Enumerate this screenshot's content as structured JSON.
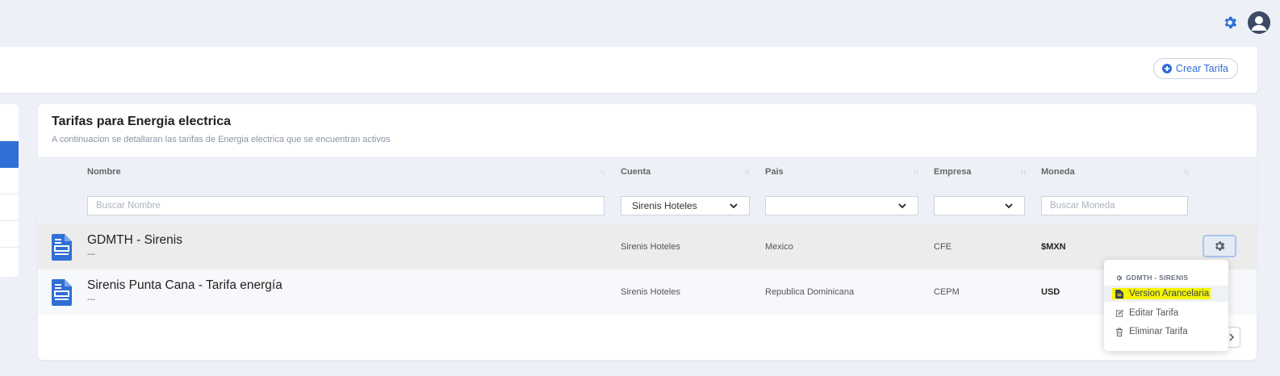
{
  "header": {
    "create_button": "Crear Tarifa"
  },
  "card": {
    "title": "Tarifas para Energia electrica",
    "subtitle": "A continuacion se detallaran las tarifas de Energia electrica que se encuentran activos"
  },
  "table": {
    "columns": [
      "Nombre",
      "Cuenta",
      "Pais",
      "Empresa",
      "Moneda"
    ],
    "sort_glyph": "↑↓",
    "filters": {
      "nombre_placeholder": "Buscar Nombre",
      "cuenta_selected": "Sirenis Hoteles",
      "pais_selected": "",
      "empresa_selected": "",
      "moneda_placeholder": "Buscar Moneda"
    },
    "rows": [
      {
        "nombre": "GDMTH - Sirenis",
        "sub": "---",
        "cuenta": "Sirenis Hoteles",
        "pais": "Mexico",
        "empresa": "CFE",
        "moneda": "$MXN"
      },
      {
        "nombre": "Sirenis Punta Cana - Tarifa energía",
        "sub": "---",
        "cuenta": "Sirenis Hoteles",
        "pais": "Republica Dominicana",
        "empresa": "CEPM",
        "moneda": "USD"
      }
    ]
  },
  "dropdown": {
    "header": "GDMTH - SIRENIS",
    "items": [
      "Version Arancelaria",
      "Editar Tarifa",
      "Eliminar Tarifa"
    ]
  },
  "icons": {
    "top_gear": "gear-icon",
    "avatar": "user-avatar-icon",
    "create": "plus-circle-icon",
    "row_icon": "document-icon",
    "row_action": "gear-icon",
    "version": "file-icon",
    "edit": "edit-icon",
    "delete": "trash-icon"
  },
  "colors": {
    "accent": "#2f6fd6",
    "highlight": "#f5f500",
    "background": "#edf1f7"
  }
}
